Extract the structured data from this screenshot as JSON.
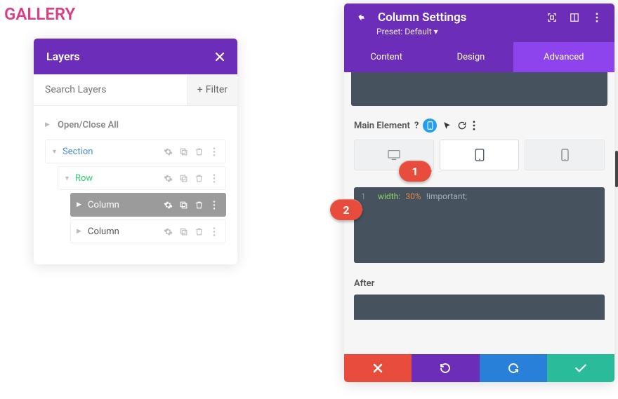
{
  "page": {
    "title": "GALLERY"
  },
  "layers": {
    "title": "Layers",
    "search_placeholder": "Search Layers",
    "filter_label": "Filter",
    "open_close": "Open/Close All",
    "section_label": "Section",
    "row_label": "Row",
    "column_label": "Column"
  },
  "settings": {
    "title": "Column Settings",
    "preset": "Preset: Default ▾",
    "tabs": {
      "content": "Content",
      "design": "Design",
      "advanced": "Advanced"
    },
    "main_element": "Main Element",
    "after_label": "After",
    "code": {
      "line_no": "1",
      "property": "width",
      "colon": ":",
      "value": "30%",
      "important": "!important",
      "semi": ";"
    }
  },
  "anno": {
    "one": "1",
    "two": "2"
  }
}
